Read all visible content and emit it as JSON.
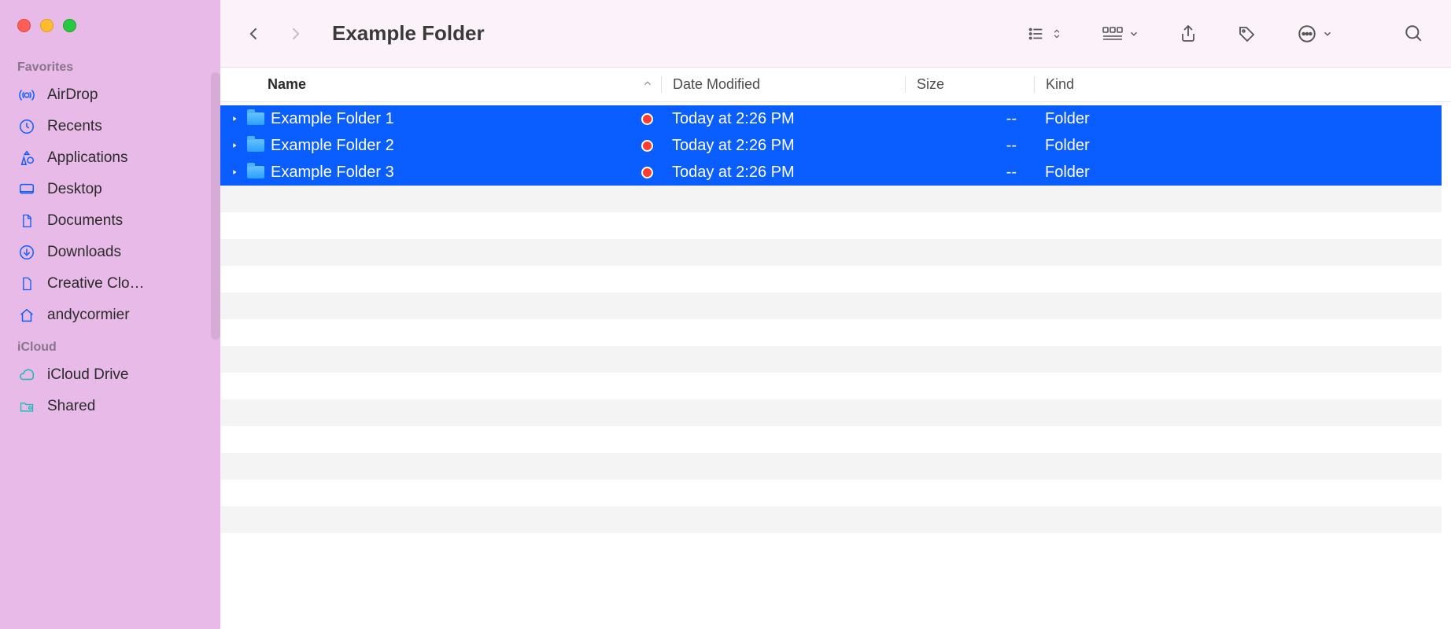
{
  "window": {
    "title": "Example Folder"
  },
  "sidebar": {
    "sections": [
      {
        "title": "Favorites",
        "items": [
          {
            "label": "AirDrop",
            "icon": "airdrop"
          },
          {
            "label": "Recents",
            "icon": "clock"
          },
          {
            "label": "Applications",
            "icon": "apps"
          },
          {
            "label": "Desktop",
            "icon": "desktop"
          },
          {
            "label": "Documents",
            "icon": "document"
          },
          {
            "label": "Downloads",
            "icon": "download"
          },
          {
            "label": "Creative Clo…",
            "icon": "file"
          },
          {
            "label": "andycormier",
            "icon": "home"
          }
        ]
      },
      {
        "title": "iCloud",
        "items": [
          {
            "label": "iCloud Drive",
            "icon": "cloud",
            "iconColor": "#19b9b4"
          },
          {
            "label": "Shared",
            "icon": "shared",
            "iconColor": "#19b9b4"
          }
        ]
      }
    ]
  },
  "columns": {
    "name": "Name",
    "date_modified": "Date Modified",
    "size": "Size",
    "kind": "Kind",
    "sort_column": "name",
    "sort_direction": "asc"
  },
  "rows": [
    {
      "name": "Example Folder 1",
      "date_modified": "Today at 2:26 PM",
      "size": "--",
      "kind": "Folder",
      "tag": "red",
      "selected": true
    },
    {
      "name": "Example Folder 2",
      "date_modified": "Today at 2:26 PM",
      "size": "--",
      "kind": "Folder",
      "tag": "red",
      "selected": true
    },
    {
      "name": "Example Folder 3",
      "date_modified": "Today at 2:26 PM",
      "size": "--",
      "kind": "Folder",
      "tag": "red",
      "selected": true
    }
  ],
  "empty_stripe_count": 13
}
